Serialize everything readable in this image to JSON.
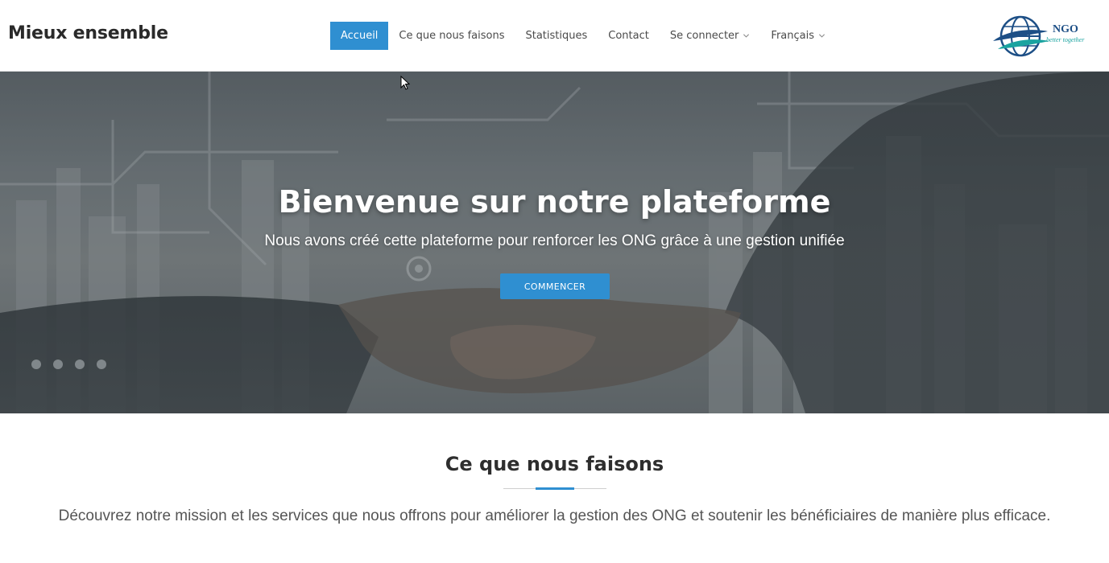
{
  "header": {
    "brand": "Mieux ensemble",
    "nav": [
      {
        "label": "Accueil",
        "active": true
      },
      {
        "label": "Ce que nous faisons"
      },
      {
        "label": "Statistiques"
      },
      {
        "label": "Contact"
      },
      {
        "label": "Se connecter",
        "dropdown": true
      },
      {
        "label": "Français",
        "dropdown": true
      }
    ],
    "logo": {
      "text": "NGO",
      "tagline": "better together"
    }
  },
  "hero": {
    "title": "Bienvenue sur notre plateforme",
    "subtitle": "Nous avons créé cette plateforme pour renforcer les ONG grâce à une gestion unifiée",
    "button": "COMMENCER"
  },
  "section": {
    "title": "Ce que nous faisons",
    "text": "Découvrez notre mission et les services que nous offrons pour améliorer la gestion des ONG et soutenir les bénéficiaires de manière plus efficace."
  },
  "colors": {
    "accent": "#2f8fd1",
    "logo_teal": "#1aa3a0",
    "logo_navy": "#1d4f86"
  }
}
